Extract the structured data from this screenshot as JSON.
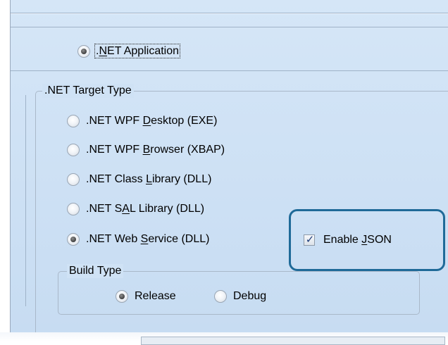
{
  "top_option": {
    "label": ".NET Application",
    "accel": "N",
    "checked": true
  },
  "target_type": {
    "legend": ".NET Target Type",
    "options": [
      {
        "pre": ".NET WPF ",
        "accel": "D",
        "post": "esktop (EXE)",
        "checked": false
      },
      {
        "pre": ".NET WPF ",
        "accel": "B",
        "post": "rowser (XBAP)",
        "checked": false
      },
      {
        "pre": ".NET Class ",
        "accel": "L",
        "post": "ibrary (DLL)",
        "checked": false
      },
      {
        "pre": ".NET S",
        "accel": "A",
        "post": "L Library (DLL)",
        "checked": false
      },
      {
        "pre": ".NET Web ",
        "accel": "S",
        "post": "ervice (DLL)",
        "checked": true
      }
    ]
  },
  "enable_json": {
    "pre": "Enable ",
    "accel": "J",
    "post": "SON",
    "checked": true
  },
  "build_type": {
    "legend": "Build Type",
    "release_label": "Release",
    "debug_label": "Debug",
    "selected": "Release"
  },
  "colors": {
    "panel_bg": "#cfe2f5",
    "highlight_border": "#1f6a98"
  }
}
